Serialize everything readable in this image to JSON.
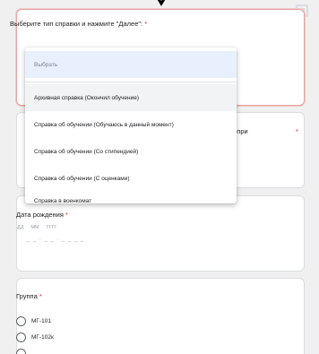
{
  "form": {
    "q1": {
      "title": "Выберите тип справки и нажмите \"Далее\":",
      "required_mark": "*"
    },
    "q2": {
      "title_tail": "лию при",
      "required_mark": "*"
    },
    "q3": {
      "title": "Дата рождения",
      "required_mark": "*",
      "parts": {
        "day": "ДД",
        "month": "ММ",
        "year": "ГГГГ"
      },
      "input_mask": "_ _ . _ _ . _ _ _ _"
    },
    "q4": {
      "title": "Группа",
      "required_mark": "*",
      "options": [
        "МГ-101",
        "МГ-102к"
      ]
    }
  },
  "dropdown": {
    "placeholder": "Выбрать",
    "options": [
      "Архивная справка (Окончил обучение)",
      "Справка об обучении (Обучаюсь в данный момент)",
      "Справка об обучении (Со стипендией)",
      "Справка об обучении (С оценками)",
      "Справка в военкомат"
    ]
  },
  "colors": {
    "required": "#d93025",
    "placeholder_bg": "#e8f0fe",
    "hover_bg": "#f1f3f4"
  },
  "icons": {
    "side": "import-icon"
  }
}
